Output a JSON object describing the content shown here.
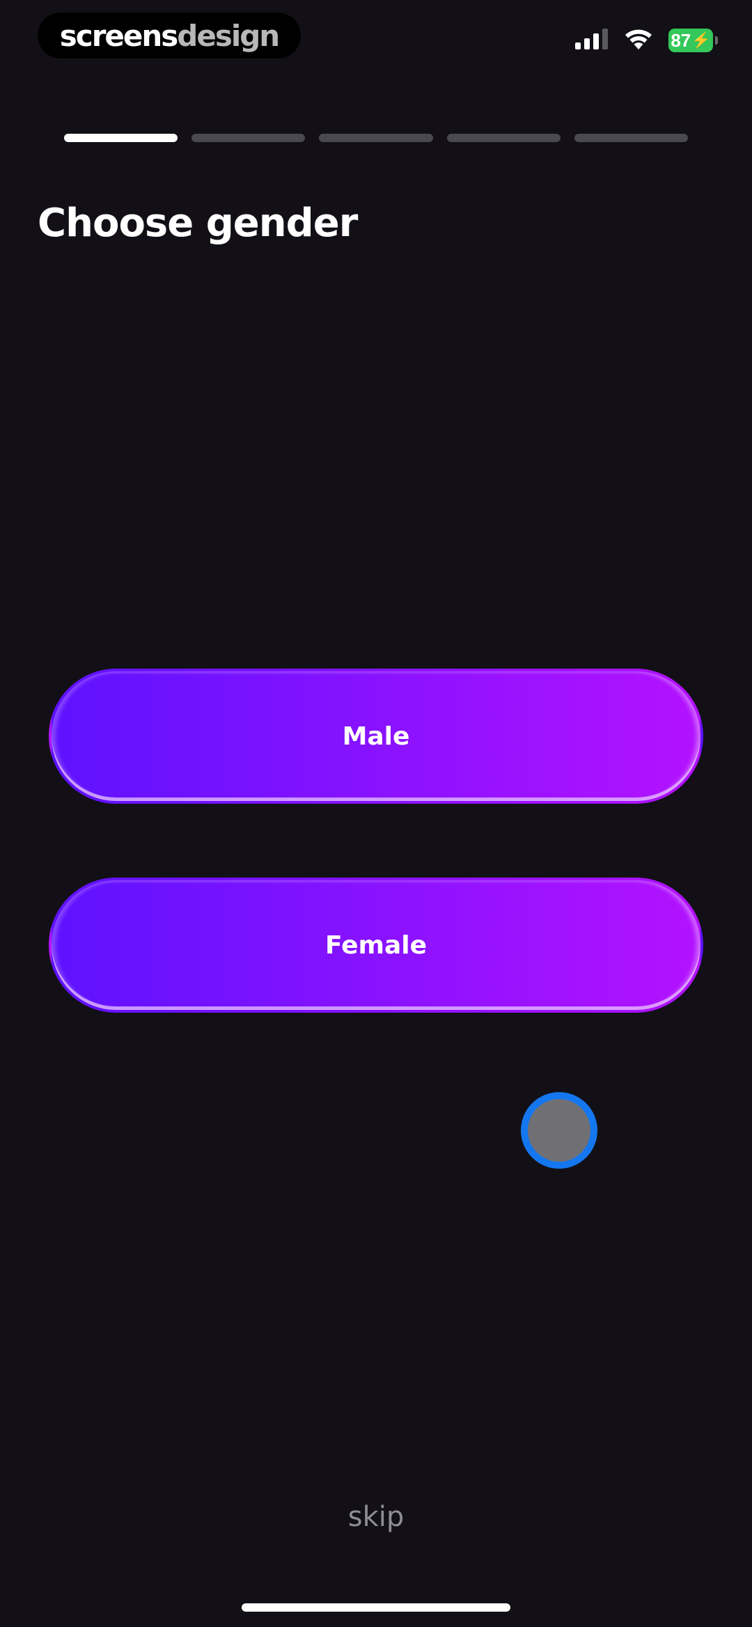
{
  "status_bar": {
    "brand_part1": "screens",
    "brand_part2": "design",
    "battery_level": "87",
    "icons": [
      "cellular-signal-icon",
      "wifi-icon",
      "battery-icon"
    ]
  },
  "progress": {
    "total_steps": 5,
    "current_step": 1
  },
  "page": {
    "title": "Choose gender"
  },
  "options": {
    "male_label": "Male",
    "female_label": "Female"
  },
  "footer": {
    "skip_label": "skip"
  },
  "colors": {
    "background": "#121016",
    "gradient_start": "#5e12ff",
    "gradient_end": "#b312ff",
    "progress_active": "#ffffff",
    "progress_inactive": "#4a4950",
    "skip_text": "#8e8d93",
    "touch_ring": "#1477f0",
    "battery": "#34c759"
  }
}
